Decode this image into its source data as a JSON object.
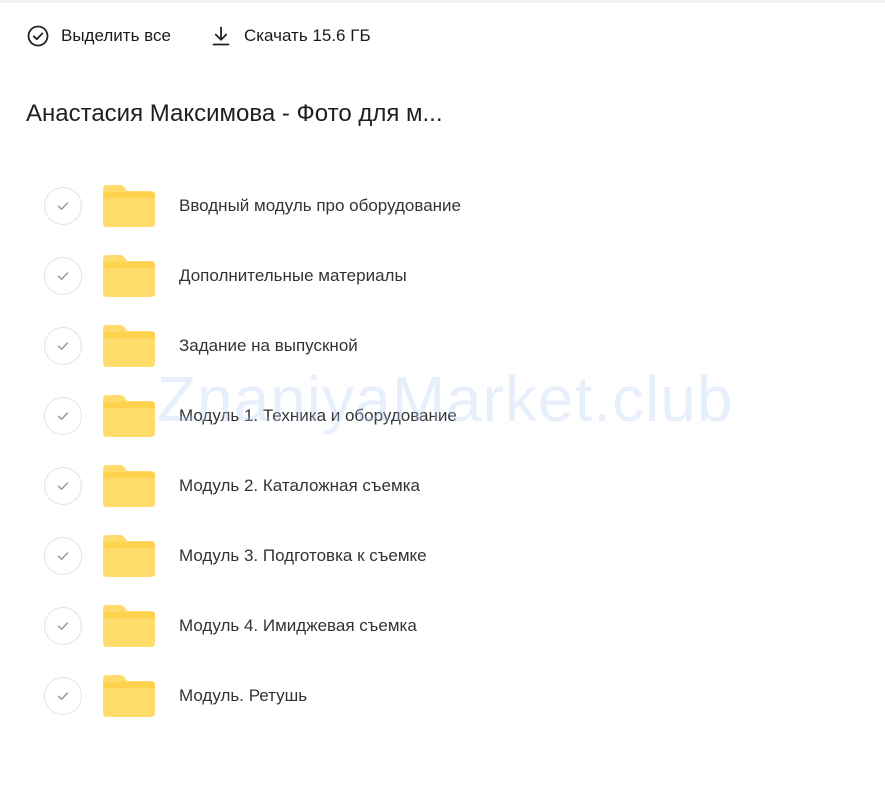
{
  "toolbar": {
    "select_all_label": "Выделить все",
    "download_label": "Скачать 15.6 ГБ"
  },
  "folder": {
    "title": "Анастасия Максимова - Фото для м..."
  },
  "items": [
    {
      "name": "Вводный модуль про оборудование"
    },
    {
      "name": "Дополнительные материалы"
    },
    {
      "name": "Задание на выпускной"
    },
    {
      "name": "Модуль 1. Техника и оборудование"
    },
    {
      "name": "Модуль 2. Каталожная съемка"
    },
    {
      "name": "Модуль 3. Подготовка к съемке"
    },
    {
      "name": "Модуль 4. Имиджевая съемка"
    },
    {
      "name": "Модуль. Ретушь"
    }
  ],
  "watermark": "ZnaniyaMarket.club",
  "colors": {
    "folder_fill": "#FFDB6B",
    "folder_tab": "#FFD24D",
    "check_mark": "#9a9a9a"
  },
  "icons": {
    "select_all": "check-circle-icon",
    "download": "download-icon",
    "item_check": "check-icon",
    "folder": "folder-icon"
  }
}
